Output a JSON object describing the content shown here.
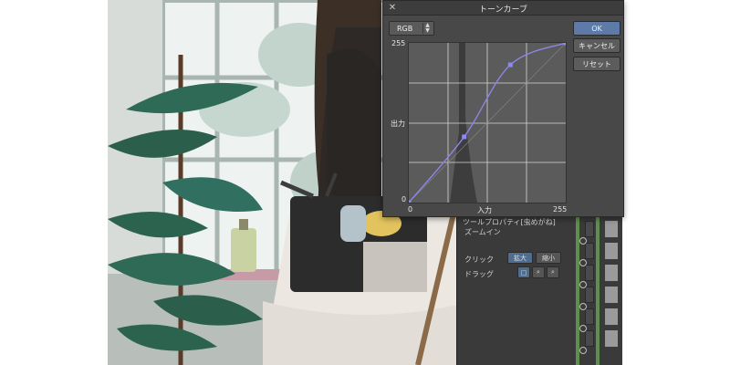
{
  "dialog": {
    "title": "トーンカーブ",
    "close_icon": "close-icon",
    "channel": {
      "value": "RGB",
      "icon": "up-down-arrow-icon"
    },
    "labels": {
      "max_top": "255",
      "output": "出力",
      "min_left": "0",
      "min_bottom": "0",
      "input": "入力",
      "max_bottom": "255"
    },
    "buttons": {
      "ok": "OK",
      "cancel": "キャンセル",
      "reset": "リセット"
    },
    "curve_points": [
      {
        "input": 0,
        "output": 0
      },
      {
        "input": 90,
        "output": 105
      },
      {
        "input": 165,
        "output": 220
      },
      {
        "input": 255,
        "output": 255
      }
    ],
    "colors": {
      "accent": "#5d7aa8",
      "curve": "#8b86e6",
      "point": "#8e89f0"
    }
  },
  "panel": {
    "title": "ツールプロパティ[虫めがね]",
    "zoom_label": "ズームイン",
    "click_label": "クリック",
    "drag_label": "ドラッグ",
    "click_options": {
      "zoom_in": "拡大",
      "zoom_out": "縮小"
    }
  }
}
